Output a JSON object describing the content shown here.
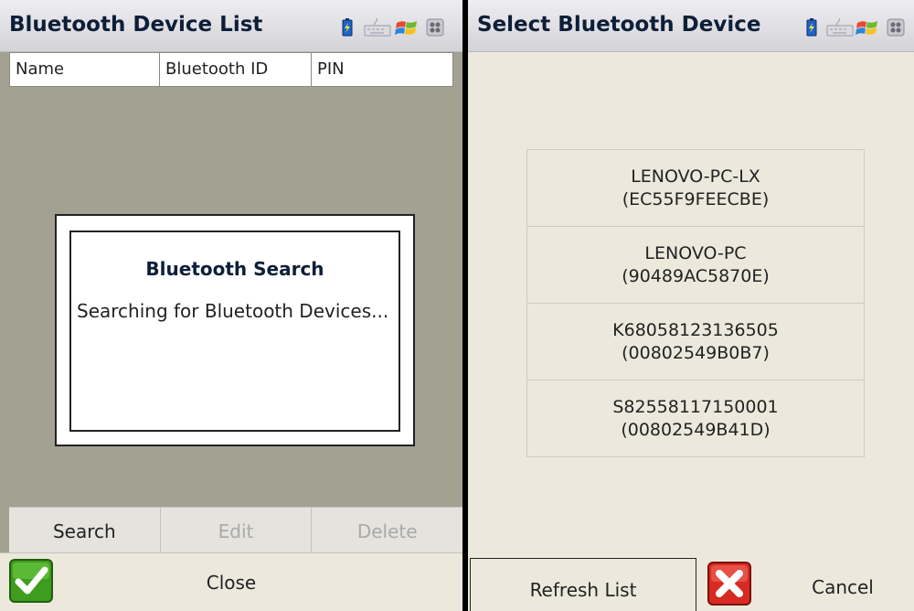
{
  "left": {
    "title": "Bluetooth Device List",
    "columns": [
      "Name",
      "Bluetooth ID",
      "PIN"
    ],
    "dialog": {
      "title": "Bluetooth Search",
      "message": "Searching for Bluetooth Devices..."
    },
    "buttons": {
      "search": "Search",
      "edit": "Edit",
      "delete": "Delete"
    },
    "close_label": "Close"
  },
  "right": {
    "title": "Select Bluetooth Device",
    "devices": [
      {
        "name": "LENOVO-PC-LX",
        "id": "(EC55F9FEECBE)"
      },
      {
        "name": "LENOVO-PC",
        "id": "(90489AC5870E)"
      },
      {
        "name": "K68058123136505",
        "id": "(00802549B0B7)"
      },
      {
        "name": "S82558117150001",
        "id": "(00802549B41D)"
      }
    ],
    "refresh_label": "Refresh List",
    "cancel_label": "Cancel"
  },
  "tray_icons": [
    "battery-icon",
    "keyboard-icon",
    "windows-start-icon",
    "system-menu-icon"
  ],
  "colors": {
    "title_text": "#0d1f38",
    "left_background": "#a3a292",
    "right_background": "#ece9dc",
    "ok_green": "#3e9c1e",
    "cancel_red": "#d72a22"
  }
}
